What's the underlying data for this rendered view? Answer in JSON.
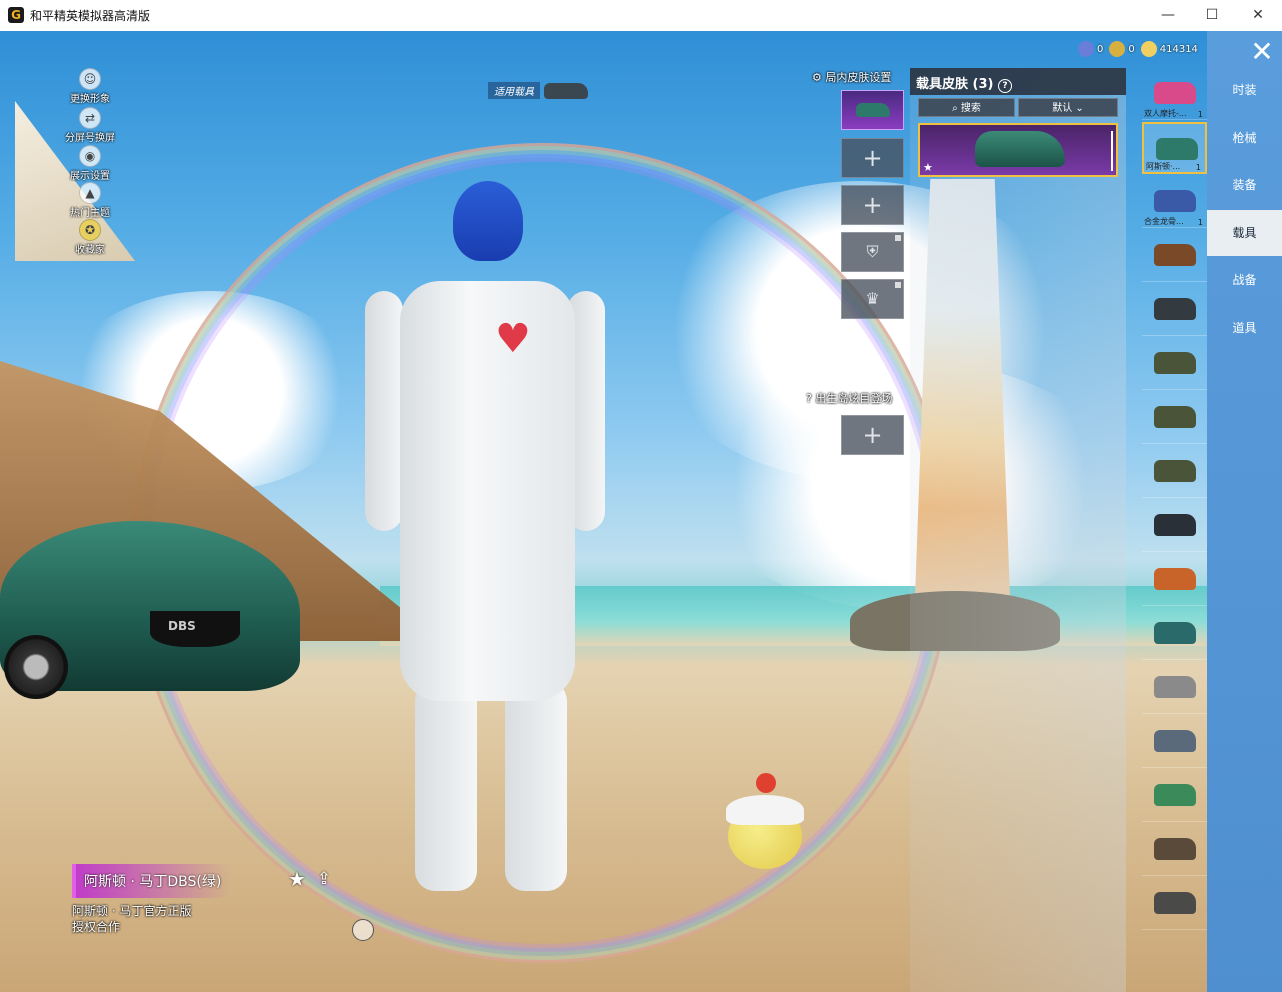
{
  "window": {
    "title": "和平精英模拟器高清版",
    "minimize": "—",
    "maximize": "☐",
    "close": "✕"
  },
  "left_menu": [
    {
      "label": "更换形象",
      "icon": "avatar-icon"
    },
    {
      "label": "分屏号换屏",
      "icon": "split-screen-icon"
    },
    {
      "label": "展示设置",
      "icon": "eye-icon"
    },
    {
      "label": "热门主题",
      "icon": "fire-icon"
    },
    {
      "label": "收藏家",
      "icon": "collector-badge-icon"
    }
  ],
  "apply_vehicle": {
    "label": "适用载具"
  },
  "currency": [
    {
      "value": "0",
      "color": "#6a7dd8",
      "icon": "premium-coin-icon"
    },
    {
      "value": "0",
      "color": "#d8b040",
      "icon": "a-coin-icon"
    },
    {
      "value": "414314",
      "color": "#f0d060",
      "icon": "gold-coin-icon"
    }
  ],
  "slots": {
    "title": "局内皮肤设置",
    "add_symbol": "+",
    "birth_title": "出生岛炫目登场"
  },
  "skin_panel": {
    "title": "载具皮肤 (3)",
    "help_symbol": "?",
    "search_label": "搜索",
    "sort_label": "默认"
  },
  "vehicle_list": [
    {
      "name": "双人摩托-...",
      "count": "1",
      "color": "#d84a8a"
    },
    {
      "name": "阿斯顿·...",
      "count": "1",
      "color": "#2e7a6a"
    },
    {
      "name": "合金龙骨...",
      "count": "1",
      "color": "#3a5aa8"
    },
    {
      "name": "",
      "count": "",
      "color": "#7a4a28"
    },
    {
      "name": "",
      "count": "",
      "color": "#333a40"
    },
    {
      "name": "",
      "count": "",
      "color": "#4a5438"
    },
    {
      "name": "",
      "count": "",
      "color": "#4a5438"
    },
    {
      "name": "",
      "count": "",
      "color": "#4a5438"
    },
    {
      "name": "",
      "count": "",
      "color": "#2a3038"
    },
    {
      "name": "",
      "count": "",
      "color": "#c8642a"
    },
    {
      "name": "",
      "count": "",
      "color": "#2a6a6a"
    },
    {
      "name": "",
      "count": "",
      "color": "#8a8a8a"
    },
    {
      "name": "",
      "count": "",
      "color": "#5a6a7a"
    },
    {
      "name": "",
      "count": "",
      "color": "#3a8a5a"
    },
    {
      "name": "",
      "count": "",
      "color": "#5a4a3a"
    },
    {
      "name": "",
      "count": "",
      "color": "#4a4a48"
    }
  ],
  "categories": [
    "时装",
    "枪械",
    "装备",
    "载具",
    "战备",
    "道具"
  ],
  "close_symbol": "✕",
  "vehicle_info": {
    "name": "阿斯顿 · 马丁DBS(绿)",
    "license_line1": "阿斯顿 · 马丁官方正版",
    "license_line2": "授权合作",
    "plate": "DBS"
  },
  "colors": {
    "accent_yellow": "#f0c040",
    "category_blue": "#5a9ddc",
    "selected_purple": "#8a3cc0"
  }
}
